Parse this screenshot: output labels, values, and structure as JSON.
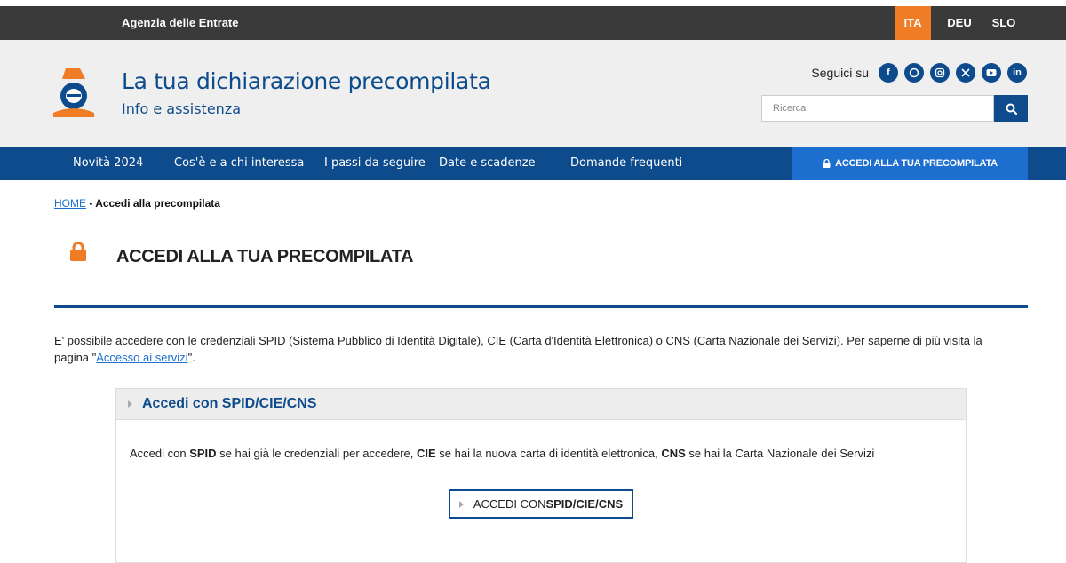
{
  "topbar": {
    "agency": "Agenzia delle Entrate",
    "languages": [
      "ITA",
      "DEU",
      "SLO"
    ],
    "active_language": "ITA"
  },
  "header": {
    "title": "La tua dichiarazione precompilata",
    "subtitle": "Info e assistenza",
    "follow_label": "Seguici su",
    "social_icons": [
      "facebook-icon",
      "whatsapp-icon",
      "instagram-icon",
      "x-icon",
      "youtube-icon",
      "linkedin-icon"
    ],
    "search_placeholder": "Ricerca"
  },
  "nav": {
    "items": [
      "Novità 2024",
      "Cos'è e a chi interessa",
      "I passi da seguire",
      "Date e scadenze",
      "Domande frequenti"
    ],
    "cta": "ACCEDI ALLA TUA PRECOMPILATA"
  },
  "breadcrumb": {
    "home": "HOME",
    "separator": " - ",
    "current": "Accedi alla precompilata"
  },
  "page": {
    "title": "ACCEDI ALLA TUA PRECOMPILATA",
    "intro_before_link": "E' possibile accedere con le credenziali SPID (Sistema Pubblico di Identità Digitale), CIE (Carta d'Identità Elettronica) o CNS (Carta Nazionale dei Servizi). Per saperne di più visita la pagina \"",
    "intro_link": "Accesso ai servizi",
    "intro_after_link": "\"."
  },
  "panel": {
    "title": "Accedi con SPID/CIE/CNS",
    "text_parts": [
      "Accedi con ",
      "SPID",
      " se hai già le credenziali per accedere, ",
      "CIE",
      " se hai la nuova carta di identità elettronica, ",
      "CNS",
      " se hai la Carta Nazionale dei Servizi"
    ],
    "button_prefix": "ACCEDI CON ",
    "button_bold": "SPID/CIE/CNS"
  },
  "colors": {
    "primary": "#0d4b8c",
    "accent_orange": "#f07c26",
    "cta_blue": "#1d6fcf",
    "topbar": "#3a3a3a"
  }
}
